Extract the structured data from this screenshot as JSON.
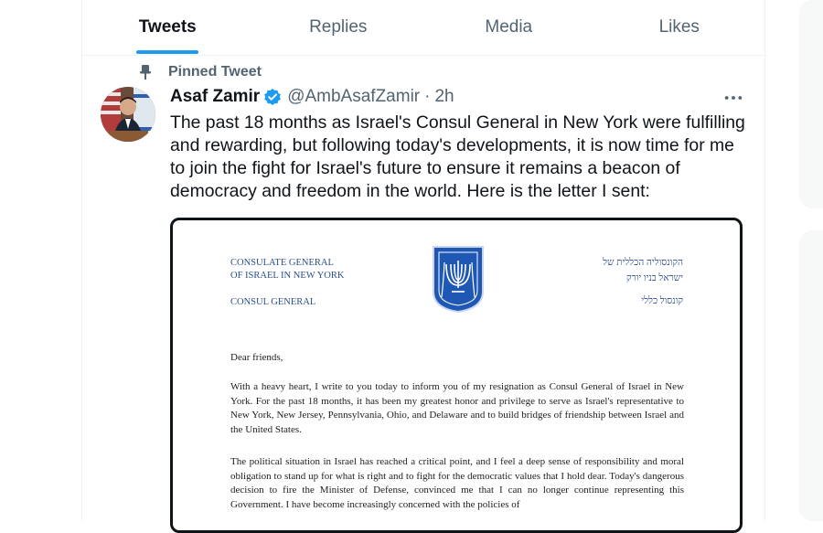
{
  "tabs": [
    {
      "label": "Tweets",
      "active": true
    },
    {
      "label": "Replies",
      "active": false
    },
    {
      "label": "Media",
      "active": false
    },
    {
      "label": "Likes",
      "active": false
    }
  ],
  "pinned_label": "Pinned Tweet",
  "tweet": {
    "author_name": "Asaf Zamir",
    "handle": "@AmbAsafZamir",
    "separator": "·",
    "time": "2h",
    "text": "The past 18 months as Israel's Consul General in New York were fulfilling\nand rewarding, but following today's developments, it is now time for me\nto join the fight for Israel's future to ensure it remains a beacon of\ndemocracy and freedom in the world. Here is the letter I sent:"
  },
  "letter": {
    "org_en_line1": "CONSULATE GENERAL",
    "org_en_line2": "OF ISRAEL IN NEW YORK",
    "title_en": "CONSUL GENERAL",
    "org_he_line1": "הקונסוליה הכללית של",
    "org_he_line2": "ישראל בניו יורק",
    "title_he": "קונסול כללי",
    "greeting": "Dear friends,",
    "paragraph1": "With a heavy heart, I write to you today to inform you of my resignation as Consul General of Israel in New York. For the past 18 months, it has been my greatest honor and privilege to serve as Israel's representative to New York, New Jersey, Pennsylvania, Ohio, and Delaware and to build bridges of friendship between Israel and the United States.",
    "paragraph2": "The political situation in Israel has reached a critical point, and I feel a deep sense of responsibility and moral obligation to stand up for what is right and to fight for the democratic values that I hold dear. Today's dangerous decision to fire the Minister of Defense, convinced me that I can no longer continue representing this Government. I have become increasingly concerned with the policies of"
  },
  "colors": {
    "accent": "#1d9bf0",
    "text_primary": "#0f1419",
    "text_secondary": "#536471",
    "letterhead_blue": "#2b4f8c"
  },
  "icons": {
    "pin": "pin-icon",
    "verified": "verified-badge-icon",
    "more": "more-options-icon",
    "emblem": "israel-emblem-icon"
  }
}
